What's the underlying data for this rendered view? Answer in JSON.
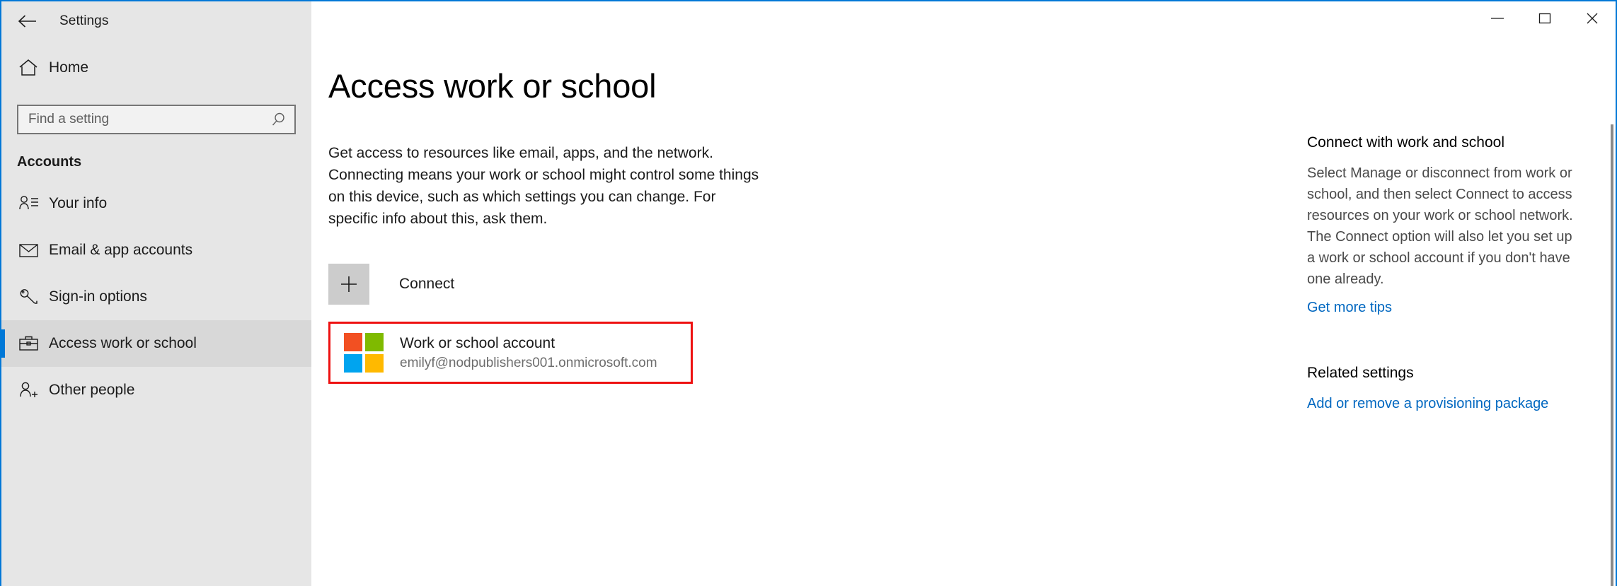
{
  "window": {
    "title": "Settings",
    "accent_color": "#0078d7",
    "back_icon": "back-arrow-icon",
    "minimize_label": "Minimize",
    "maximize_label": "Maximize",
    "close_label": "Close"
  },
  "sidebar": {
    "home_label": "Home",
    "home_icon": "home-icon",
    "search": {
      "placeholder": "Find a setting",
      "value": "",
      "icon": "search-icon"
    },
    "section_title": "Accounts",
    "items": [
      {
        "label": "Your info",
        "icon": "person-info-icon",
        "selected": false
      },
      {
        "label": "Email & app accounts",
        "icon": "envelope-icon",
        "selected": false
      },
      {
        "label": "Sign-in options",
        "icon": "key-icon",
        "selected": false
      },
      {
        "label": "Access work or school",
        "icon": "briefcase-icon",
        "selected": true
      },
      {
        "label": "Other people",
        "icon": "person-add-icon",
        "selected": false
      }
    ]
  },
  "main": {
    "page_title": "Access work or school",
    "intro": "Get access to resources like email, apps, and the network. Connecting means your work or school might control some things on this device, such as which settings you can change. For specific info about this, ask them.",
    "connect": {
      "label": "Connect",
      "icon": "plus-icon"
    },
    "account": {
      "name": "Work or school account",
      "email": "emilyf@nodpublishers001.onmicrosoft.com",
      "logo_icon": "microsoft-logo-icon",
      "highlight_color": "#ee1111",
      "logo_colors": {
        "top_left": "#f25022",
        "top_right": "#7fba00",
        "bottom_left": "#00a4ef",
        "bottom_right": "#ffb900"
      }
    }
  },
  "rail": {
    "connect_heading": "Connect with work and school",
    "connect_body": "Select Manage or disconnect from work or school, and then select Connect to access resources on your work or school network. The Connect option will also let you set up a work or school account if you don't have one already.",
    "tips_link": "Get more tips",
    "related_heading": "Related settings",
    "provisioning_link": "Add or remove a provisioning package",
    "link_color": "#0067c0"
  }
}
